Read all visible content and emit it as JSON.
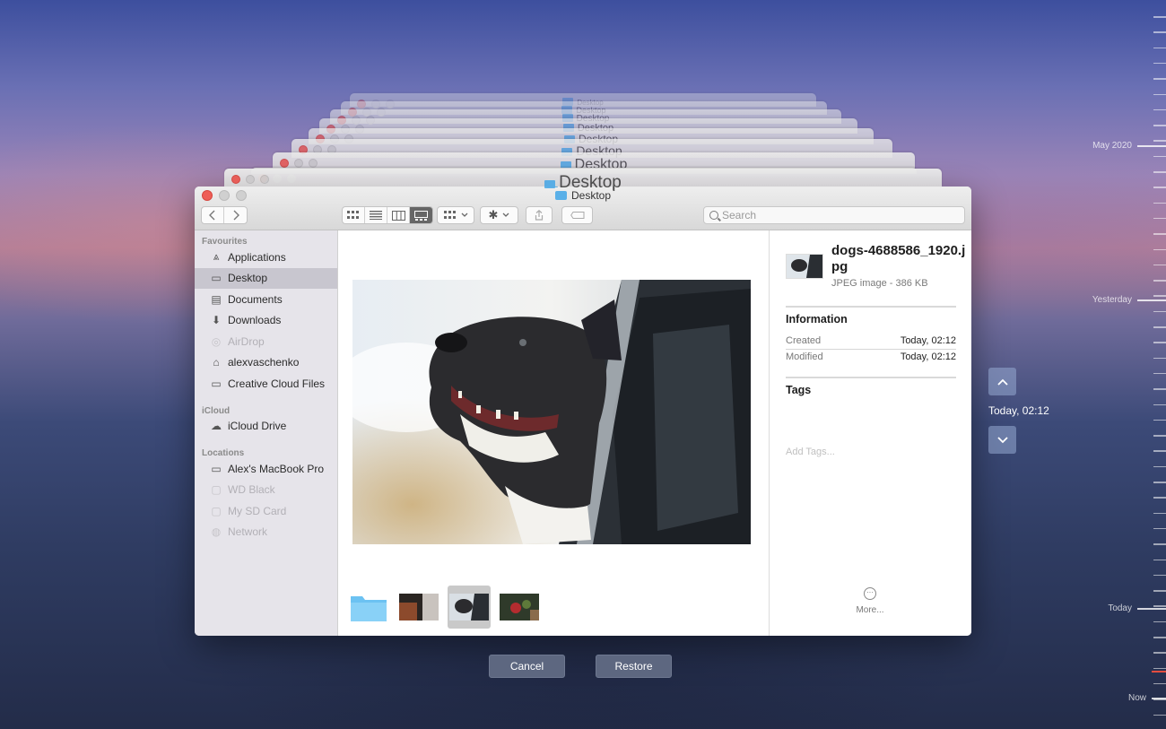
{
  "stack": {
    "titles": [
      "Desktop",
      "Desktop",
      "Desktop",
      "Desktop",
      "Desktop",
      "Desktop",
      "Desktop",
      "Desktop",
      "Desktop"
    ]
  },
  "window": {
    "title": "Desktop",
    "search_placeholder": "Search"
  },
  "sidebar": {
    "sections": [
      {
        "heading": "Favourites",
        "items": [
          {
            "label": "Applications",
            "icon": "applications-icon"
          },
          {
            "label": "Desktop",
            "icon": "desktop-icon",
            "selected": true
          },
          {
            "label": "Documents",
            "icon": "documents-icon"
          },
          {
            "label": "Downloads",
            "icon": "downloads-icon"
          },
          {
            "label": "AirDrop",
            "icon": "airdrop-icon",
            "disabled": true
          },
          {
            "label": "alexvaschenko",
            "icon": "home-icon"
          },
          {
            "label": "Creative Cloud Files",
            "icon": "folder-icon"
          }
        ]
      },
      {
        "heading": "iCloud",
        "items": [
          {
            "label": "iCloud Drive",
            "icon": "cloud-icon"
          }
        ]
      },
      {
        "heading": "Locations",
        "items": [
          {
            "label": "Alex's MacBook Pro",
            "icon": "laptop-icon"
          },
          {
            "label": "WD Black",
            "icon": "drive-icon",
            "disabled": true
          },
          {
            "label": "My SD Card",
            "icon": "drive-icon",
            "disabled": true
          },
          {
            "label": "Network",
            "icon": "network-icon",
            "disabled": true
          }
        ]
      }
    ]
  },
  "info": {
    "filename": "dogs-4688586_1920.jpg",
    "filemeta": "JPEG image - 386 KB",
    "information_title": "Information",
    "created_label": "Created",
    "created_value": "Today, 02:12",
    "modified_label": "Modified",
    "modified_value": "Today, 02:12",
    "tags_title": "Tags",
    "tags_placeholder": "Add Tags...",
    "more_label": "More..."
  },
  "buttons": {
    "cancel": "Cancel",
    "restore": "Restore"
  },
  "navigation": {
    "current_time": "Today, 02:12"
  },
  "timeline": {
    "labels": [
      "May 2020",
      "Yesterday",
      "Today",
      "Now"
    ]
  },
  "colors": {
    "accent_red": "#e44d3f",
    "folder_blue": "#5ab0e8",
    "button_bg": "#5d6780"
  }
}
